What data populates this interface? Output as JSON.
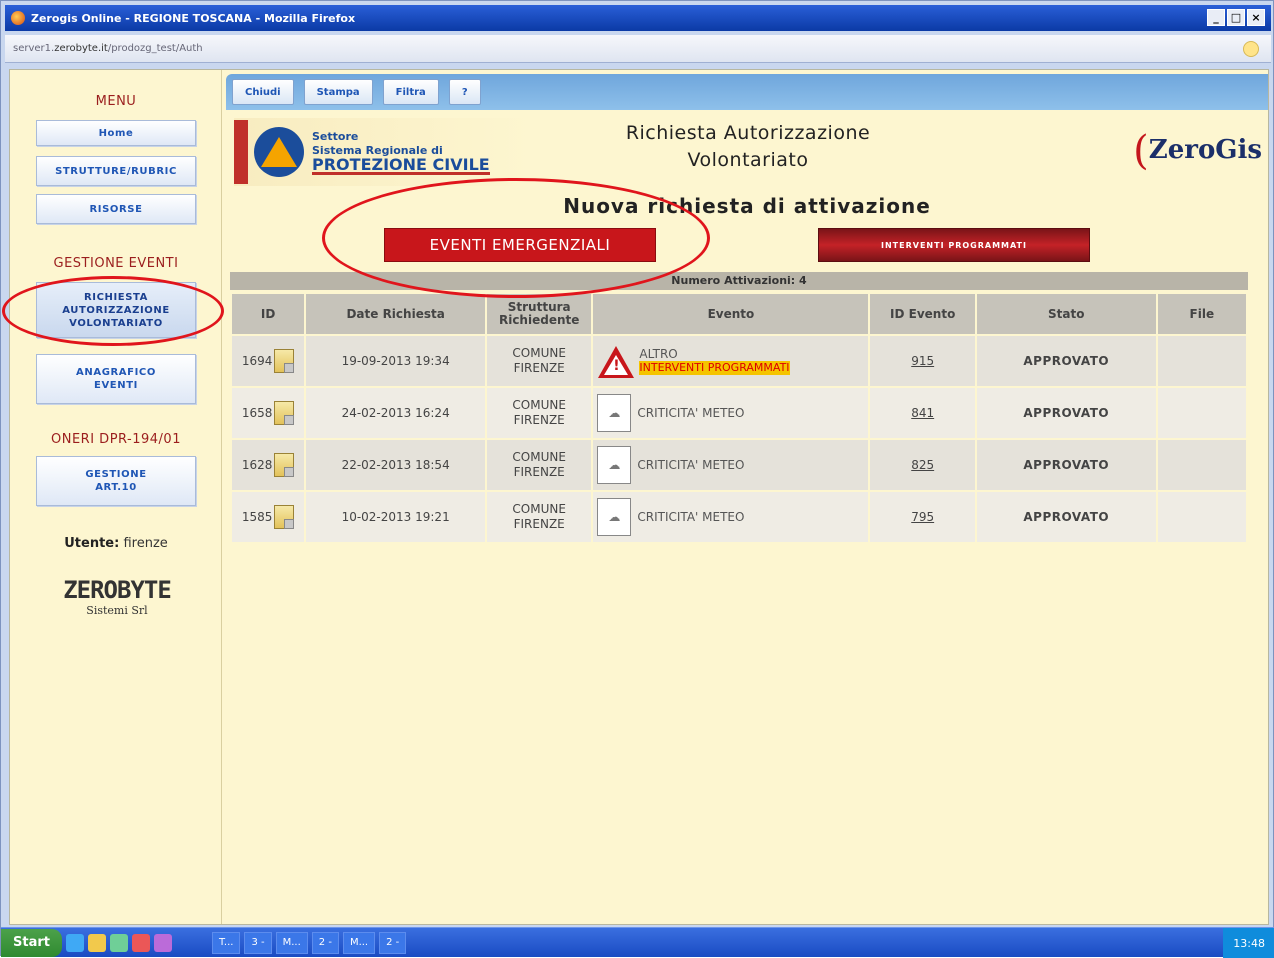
{
  "window": {
    "title": "Zerogis Online - REGIONE TOSCANA - Mozilla Firefox",
    "url_prefix": "server1.",
    "url_domain": "zerobyte.it",
    "url_path": "/prodozg_test/Auth",
    "controls": [
      "_",
      "□",
      "×"
    ]
  },
  "sidebar": {
    "menu_title": "MENU",
    "menu_items": [
      "Home",
      "STRUTTURE/RUBRIC",
      "RISORSE"
    ],
    "events_title": "GESTIONE EVENTI",
    "events_items": [
      "RICHIESTA AUTORIZZAZIONE VOLONTARIATO",
      "ANAGRAFICO EVENTI"
    ],
    "oneri_title": "ONERI DPR-194/01",
    "oneri_items": [
      "GESTIONE ART.10"
    ],
    "user_label": "Utente:",
    "user_value": "firenze",
    "company_logo": "ZEROBYTE",
    "company_sub": "Sistemi Srl"
  },
  "toolbar": {
    "buttons": [
      "Chiudi",
      "Stampa",
      "Filtra",
      "?"
    ]
  },
  "header": {
    "org_line1": "Settore",
    "org_line2": "Sistema Regionale di",
    "org_line3": "PROTEZIONE CIVILE",
    "title_line1": "Richiesta Autorizzazione",
    "title_line2": "Volontariato",
    "brand": "ZeroGis"
  },
  "main": {
    "heading": "Nuova richiesta di attivazione",
    "btn_emergency": "EVENTI EMERGENZIALI",
    "btn_programmed": "INTERVENTI PROGRAMMATI",
    "counter": "Numero Attivazioni: 4"
  },
  "table": {
    "columns": [
      "ID",
      "Date Richiesta",
      "Struttura Richiedente",
      "Evento",
      "ID Evento",
      "Stato",
      "File"
    ],
    "rows": [
      {
        "id": "1694",
        "date": "19-09-2013 19:34",
        "struct1": "COMUNE",
        "struct2": "FIRENZE",
        "event": "ALTRO",
        "event_tag": "INTERVENTI PROGRAMMATI",
        "event_icon": "warning-icon",
        "id_event": "915",
        "stato": "APPROVATO",
        "file": ""
      },
      {
        "id": "1658",
        "date": "24-02-2013 16:24",
        "struct1": "COMUNE",
        "struct2": "FIRENZE",
        "event": "CRITICITA' METEO",
        "event_tag": "",
        "event_icon": "weather-icon",
        "id_event": "841",
        "stato": "APPROVATO",
        "file": ""
      },
      {
        "id": "1628",
        "date": "22-02-2013 18:54",
        "struct1": "COMUNE",
        "struct2": "FIRENZE",
        "event": "CRITICITA' METEO",
        "event_tag": "",
        "event_icon": "weather-icon",
        "id_event": "825",
        "stato": "APPROVATO",
        "file": ""
      },
      {
        "id": "1585",
        "date": "10-02-2013 19:21",
        "struct1": "COMUNE",
        "struct2": "FIRENZE",
        "event": "CRITICITA' METEO",
        "event_tag": "",
        "event_icon": "weather-icon",
        "id_event": "795",
        "stato": "APPROVATO",
        "file": ""
      }
    ]
  },
  "taskbar": {
    "start": "Start",
    "items": [
      "T...",
      "3 -",
      "M...",
      "2 -",
      "M...",
      "2 -"
    ],
    "clock": "13:48"
  },
  "colors": {
    "accent_red": "#c8161b",
    "status_green": "#3fa33f",
    "panel_bg": "#fdf6d0"
  }
}
